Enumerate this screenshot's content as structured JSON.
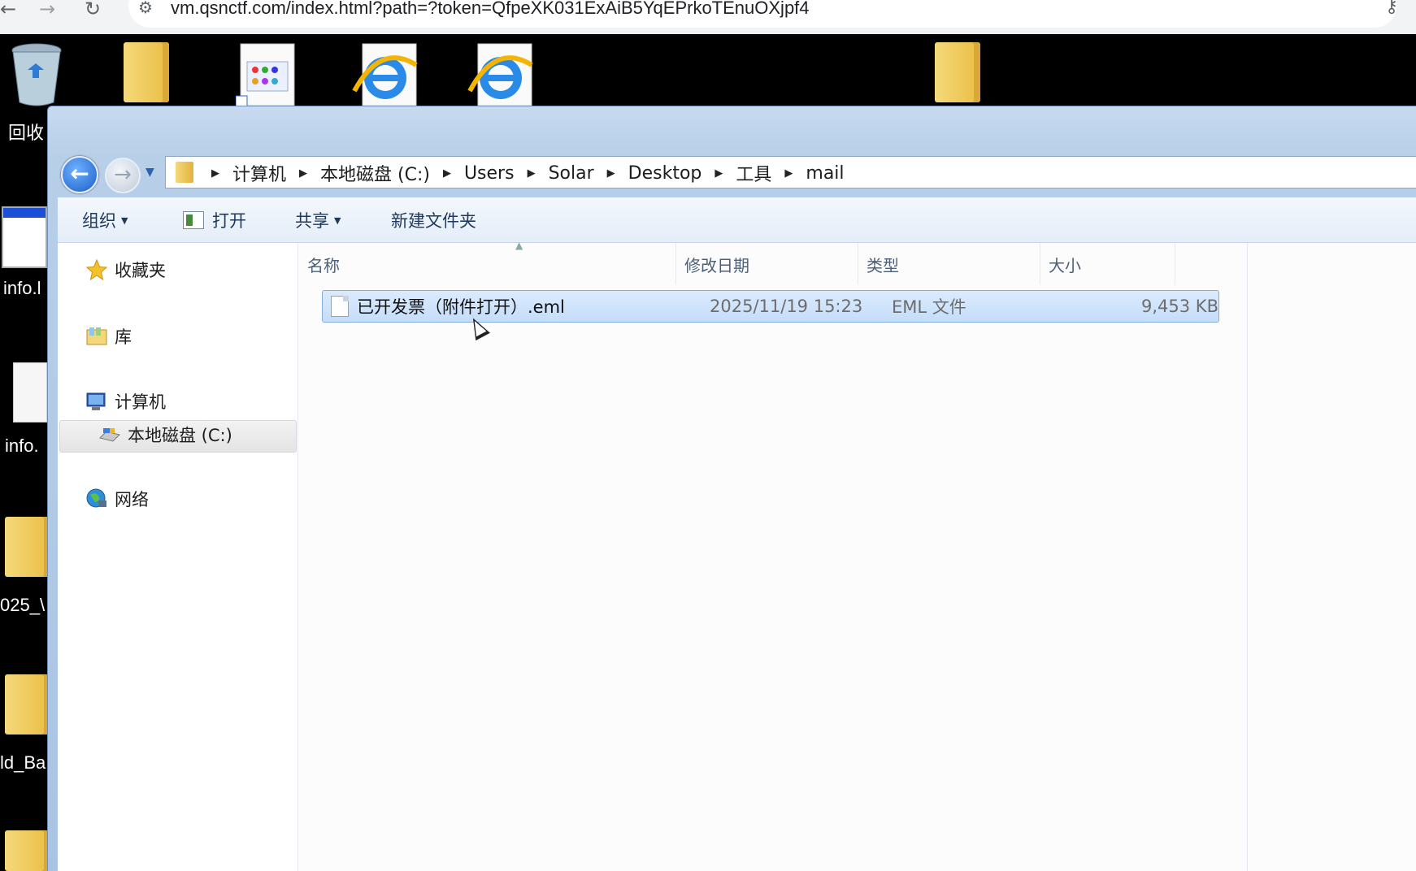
{
  "browser": {
    "url": "vm.qsnctf.com/index.html?path=?token=QfpeXK031ExAiB5YqEPrkoTEnuOXjpf4",
    "back_glyph": "←",
    "forward_glyph": "→",
    "reload_glyph": "↻",
    "tune_glyph": "⚙",
    "key_glyph": "⚷"
  },
  "desktop": {
    "labels": [
      "回收",
      "info.l",
      "info.",
      "025_\\",
      "ld_Ba"
    ]
  },
  "explorer": {
    "breadcrumbs": [
      "计算机",
      "本地磁盘 (C:)",
      "Users",
      "Solar",
      "Desktop",
      "工具",
      "mail"
    ],
    "toolbar": {
      "organize": "组织",
      "open": "打开",
      "share": "共享",
      "new_folder": "新建文件夹"
    },
    "nav": {
      "favorites": "收藏夹",
      "libraries": "库",
      "computer": "计算机",
      "local_disk": "本地磁盘 (C:)",
      "network": "网络"
    },
    "columns": {
      "name": "名称",
      "modified": "修改日期",
      "type": "类型",
      "size": "大小"
    },
    "files": [
      {
        "name": "已开发票（附件打开）.eml",
        "modified": "2025/11/19 15:23",
        "type": "EML 文件",
        "size": "9,453 KB"
      }
    ]
  },
  "colors": {
    "selection": "#c4ddfa",
    "selection_border": "#84acdd",
    "window_frame": "#b8cfe8"
  }
}
